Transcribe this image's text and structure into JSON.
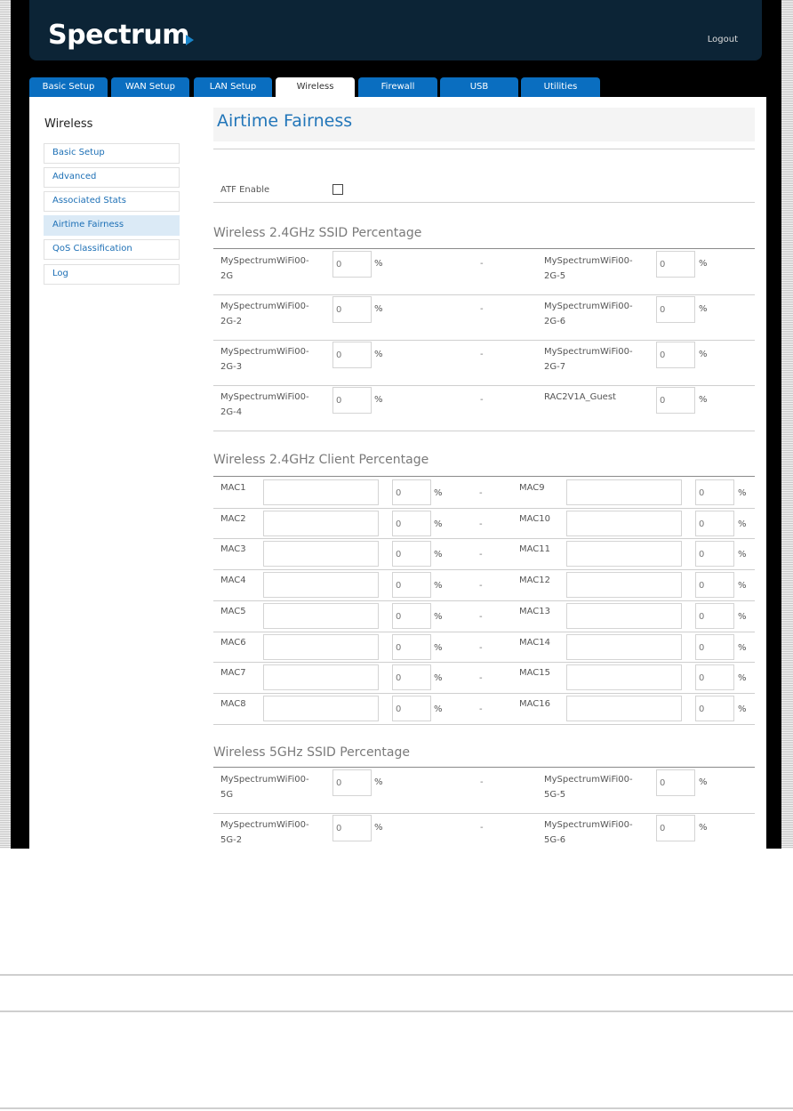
{
  "brand": {
    "logo_text": "Spectrum"
  },
  "header": {
    "logout_label": "Logout"
  },
  "tabs": [
    "Basic Setup",
    "WAN Setup",
    "LAN Setup",
    "Wireless",
    "Firewall",
    "USB",
    "Utilities"
  ],
  "sidebar": {
    "title": "Wireless",
    "items": [
      "Basic Setup",
      "Advanced",
      "Associated Stats",
      "Airtime Fairness",
      "QoS Classification",
      "Log"
    ]
  },
  "main": {
    "title": "Airtime Fairness",
    "atf_label": "ATF Enable",
    "percent": "%",
    "dash": "-"
  },
  "sections": {
    "ssid24_title": "Wireless 2.4GHz SSID Percentage",
    "client24_title": "Wireless 2.4GHz Client Percentage",
    "ssid5_title": "Wireless 5GHz SSID Percentage"
  },
  "ssid24": [
    {
      "left_l1": "MySpectrumWiFi00-",
      "left_l2": "2G",
      "left_val": "0",
      "right_l1": "MySpectrumWiFi00-",
      "right_l2": "2G-5",
      "right_val": "0"
    },
    {
      "left_l1": "MySpectrumWiFi00-",
      "left_l2": "2G-2",
      "left_val": "0",
      "right_l1": "MySpectrumWiFi00-",
      "right_l2": "2G-6",
      "right_val": "0"
    },
    {
      "left_l1": "MySpectrumWiFi00-",
      "left_l2": "2G-3",
      "left_val": "0",
      "right_l1": "MySpectrumWiFi00-",
      "right_l2": "2G-7",
      "right_val": "0"
    },
    {
      "left_l1": "MySpectrumWiFi00-",
      "left_l2": "2G-4",
      "left_val": "0",
      "right_l1": "RAC2V1A_Guest",
      "right_l2": "",
      "right_val": "0"
    }
  ],
  "clients24": [
    {
      "left": "MAC1",
      "left_val": "0",
      "right": "MAC9",
      "right_val": "0"
    },
    {
      "left": "MAC2",
      "left_val": "0",
      "right": "MAC10",
      "right_val": "0"
    },
    {
      "left": "MAC3",
      "left_val": "0",
      "right": "MAC11",
      "right_val": "0"
    },
    {
      "left": "MAC4",
      "left_val": "0",
      "right": "MAC12",
      "right_val": "0"
    },
    {
      "left": "MAC5",
      "left_val": "0",
      "right": "MAC13",
      "right_val": "0"
    },
    {
      "left": "MAC6",
      "left_val": "0",
      "right": "MAC14",
      "right_val": "0"
    },
    {
      "left": "MAC7",
      "left_val": "0",
      "right": "MAC15",
      "right_val": "0"
    },
    {
      "left": "MAC8",
      "left_val": "0",
      "right": "MAC16",
      "right_val": "0"
    }
  ],
  "ssid5": [
    {
      "left_l1": "MySpectrumWiFi00-",
      "left_l2": "5G",
      "left_val": "0",
      "right_l1": "MySpectrumWiFi00-",
      "right_l2": "5G-5",
      "right_val": "0"
    },
    {
      "left_l1": "MySpectrumWiFi00-",
      "left_l2": "5G-2",
      "left_val": "0",
      "right_l1": "MySpectrumWiFi00-",
      "right_l2": "5G-6",
      "right_val": "0"
    }
  ],
  "colors": {
    "header_bg": "#0c2436",
    "tab_bg": "#0a6ec0",
    "accent": "#2276b9",
    "sidebar_active": "#dbeaf6"
  }
}
